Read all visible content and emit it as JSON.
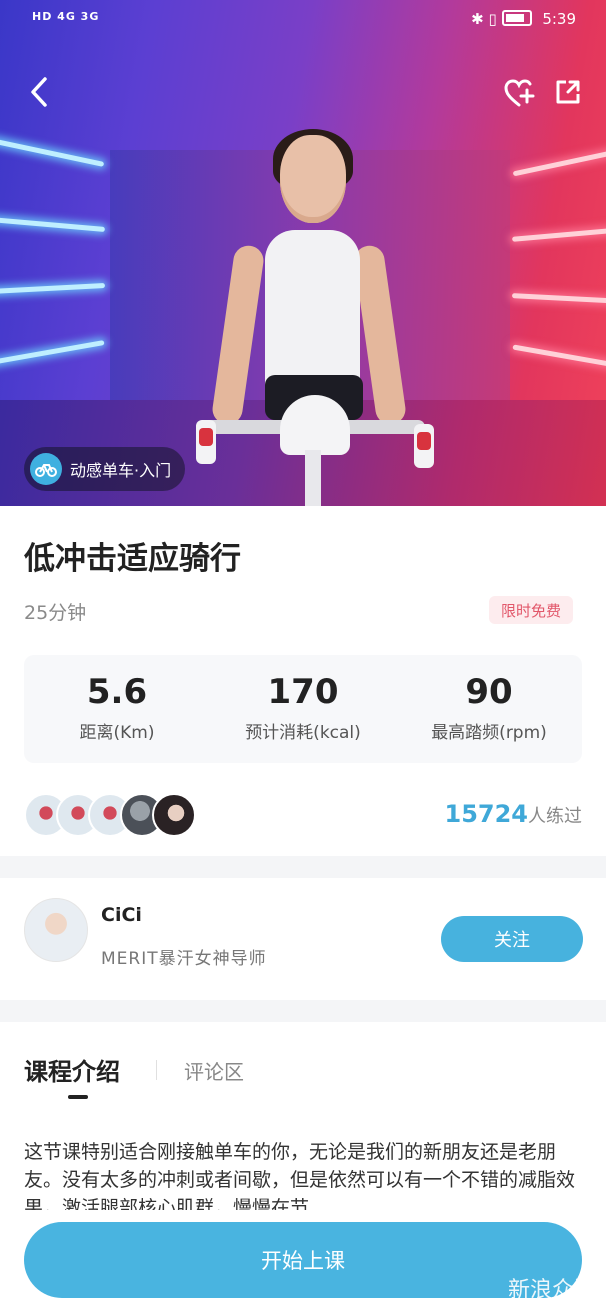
{
  "status_bar": {
    "left": "HD 4G 3G",
    "time": "5:39"
  },
  "hero": {
    "category_tag": "动感单车·入门"
  },
  "course": {
    "title": "低冲击适应骑行",
    "duration": "25分钟",
    "badge": "限时免费",
    "stats": [
      {
        "value": "5.6",
        "label": "距离(Km)"
      },
      {
        "value": "170",
        "label": "预计消耗(kcal)"
      },
      {
        "value": "90",
        "label": "最高踏频(rpm)"
      }
    ],
    "practice_count": "15724",
    "practice_suffix": "人练过"
  },
  "coach": {
    "name": "CiCi",
    "title": "MERIT暴汗女神导师",
    "follow_label": "关注"
  },
  "tabs": [
    {
      "label": "课程介绍",
      "active": true
    },
    {
      "label": "评论区",
      "active": false
    }
  ],
  "description": "这节课特别适合刚接触单车的你，无论是我们的新朋友还是老朋友。没有太多的冲刺或者间歇，但是依然可以有一个不错的减脂效果，激活腿部核心肌群，慢慢在节",
  "start_button": "开始上课",
  "watermark": "新浪众测",
  "colors": {
    "accent": "#47b2de",
    "badge_text": "#e2576a"
  }
}
